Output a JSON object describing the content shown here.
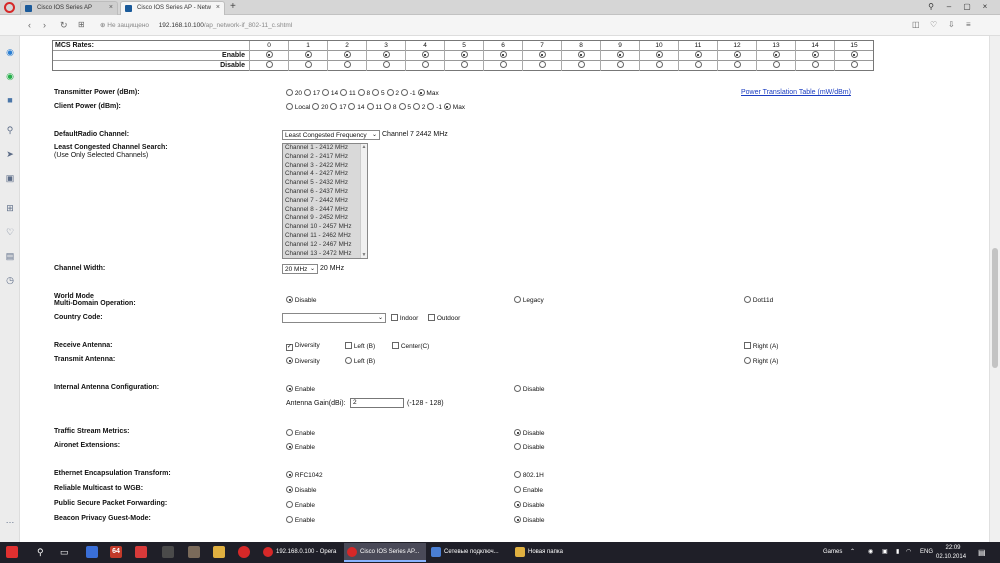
{
  "browser": {
    "tabs": [
      {
        "title": "Cisco IOS Series AP",
        "active": false
      },
      {
        "title": "Cisco IOS Series AP - Netw",
        "active": true
      }
    ],
    "new_tab": "+",
    "security_label": "Не защищено",
    "url_host": "192.168.10.100",
    "url_path": "/ap_network-if_802-11_c.shtml"
  },
  "mcs": {
    "label": "MCS Rates:",
    "columns": [
      "0",
      "1",
      "2",
      "3",
      "4",
      "5",
      "6",
      "7",
      "8",
      "9",
      "10",
      "11",
      "12",
      "13",
      "14",
      "15"
    ],
    "rows": [
      {
        "label": "Enable",
        "selected": true
      },
      {
        "label": "Disable",
        "selected": false
      }
    ]
  },
  "tx_power": {
    "label": "Transmitter Power (dBm):",
    "options": [
      "20",
      "17",
      "14",
      "11",
      "8",
      "5",
      "2",
      "-1",
      "Max"
    ],
    "selected": "Max",
    "link": "Power Translation Table (mW/dBm)"
  },
  "client_power": {
    "label": "Client Power (dBm):",
    "options": [
      "Local",
      "20",
      "17",
      "14",
      "11",
      "8",
      "5",
      "2",
      "-1",
      "Max"
    ],
    "selected": "Max"
  },
  "default_channel": {
    "label": "DefaultRadio Channel:",
    "value": "Least Congested Frequency",
    "status": "Channel 7 2442 MHz"
  },
  "least_congested": {
    "label": "Least Congested Channel Search:",
    "sublabel": "(Use Only Selected Channels)",
    "channels": [
      "Channel 1 - 2412 MHz",
      "Channel 2 - 2417 MHz",
      "Channel 3 - 2422 MHz",
      "Channel 4 - 2427 MHz",
      "Channel 5 - 2432 MHz",
      "Channel 6 - 2437 MHz",
      "Channel 7 - 2442 MHz",
      "Channel 8 - 2447 MHz",
      "Channel 9 - 2452 MHz",
      "Channel 10 - 2457 MHz",
      "Channel 11 - 2462 MHz",
      "Channel 12 - 2467 MHz",
      "Channel 13 - 2472 MHz"
    ]
  },
  "channel_width": {
    "label": "Channel Width:",
    "value": "20 MHz",
    "status": "20 MHz"
  },
  "world_mode": {
    "label": "World Mode",
    "label2": "Multi-Domain Operation:",
    "options": [
      "Disable",
      "Legacy",
      "Dot11d"
    ],
    "selected": "Disable"
  },
  "country_code": {
    "label": "Country Code:",
    "value": "",
    "checks": [
      "Indoor",
      "Outdoor"
    ]
  },
  "receive_antenna": {
    "label": "Receive Antenna:",
    "options": [
      "Diversity",
      "Left (B)",
      "Center(C)",
      "Right (A)"
    ],
    "checked": [
      "Diversity"
    ]
  },
  "transmit_antenna": {
    "label": "Transmit Antenna:",
    "options": [
      "Diversity",
      "Left (B)",
      "Right (A)"
    ],
    "selected": "Diversity"
  },
  "internal_antenna": {
    "label": "Internal Antenna Configuration:",
    "options": [
      "Enable",
      "Disable"
    ],
    "selected": "Enable",
    "gain_label": "Antenna Gain(dBi):",
    "gain_value": "2",
    "gain_range": "(-128 - 128)"
  },
  "traffic_stream": {
    "label": "Traffic Stream Metrics:",
    "options": [
      "Enable",
      "Disable"
    ],
    "selected": "Disable"
  },
  "aironet_ext": {
    "label": "Aironet Extensions:",
    "options": [
      "Enable",
      "Disable"
    ],
    "selected": "Enable"
  },
  "ethernet_encap": {
    "label": "Ethernet Encapsulation Transform:",
    "options": [
      "RFC1042",
      "802.1H"
    ],
    "selected": "RFC1042"
  },
  "reliable_multicast": {
    "label": "Reliable Multicast to WGB:",
    "options": [
      "Disable",
      "Enable"
    ],
    "selected": "Disable"
  },
  "pspf": {
    "label": "Public Secure Packet Forwarding:",
    "options": [
      "Enable",
      "Disable"
    ],
    "selected": "Disable"
  },
  "beacon_privacy": {
    "label": "Beacon Privacy Guest-Mode:",
    "options": [
      "Enable",
      "Disable"
    ],
    "selected": "Disable"
  },
  "taskbar": {
    "apps": [
      {
        "title": "192.168.0.100 - Opera",
        "active": false
      },
      {
        "title": "Cisco IOS Series AP...",
        "active": true
      },
      {
        "title": "Сетевые подключ...",
        "active": false
      },
      {
        "title": "Новая папка",
        "active": false
      }
    ],
    "badge": "64",
    "tray_label": "Games",
    "language": "ENG",
    "time": "22:09",
    "date": "02.10.2014"
  },
  "colors": {
    "opera_red": "#d62828",
    "link_blue": "#1a3cc0",
    "taskbar": "#1f1f28"
  }
}
